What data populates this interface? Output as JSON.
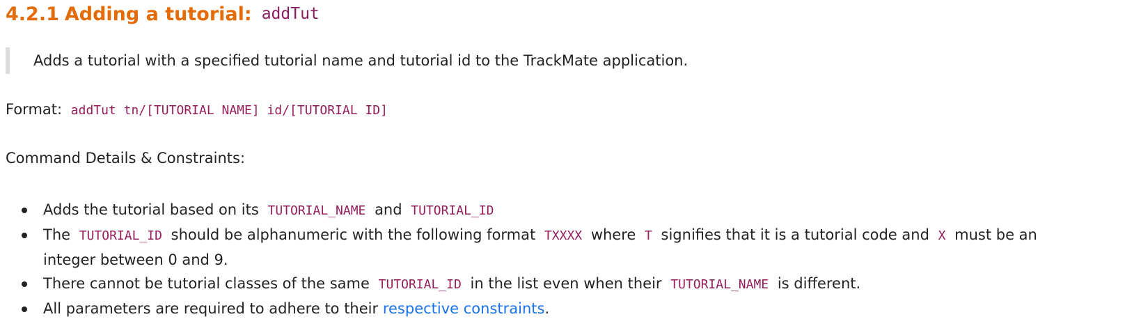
{
  "heading": {
    "number": "4.2.1",
    "title": "Adding a tutorial:",
    "command": "addTut"
  },
  "description": "Adds a tutorial with a specified tutorial name and tutorial id to the TrackMate application.",
  "format": {
    "label": "Format:",
    "syntax": "addTut tn/[TUTORIAL NAME] id/[TUTORIAL ID]"
  },
  "details_heading": "Command Details & Constraints:",
  "bullets": [
    {
      "t1": "Adds the tutorial based on its",
      "c1": "TUTORIAL_NAME",
      "t2": "and",
      "c2": "TUTORIAL_ID"
    },
    {
      "t1": "The",
      "c1": "TUTORIAL_ID",
      "t2": "should be alphanumeric with the following format",
      "c2": "TXXXX",
      "t3": "where",
      "c3": "T",
      "t4": "signifies that it is a tutorial code and",
      "c4": "X",
      "t5": "must be an integer between 0 and 9."
    },
    {
      "t1": "There cannot be tutorial classes of the same",
      "c1": "TUTORIAL_ID",
      "t2": "in the list even when their",
      "c2": "TUTORIAL_NAME",
      "t3": "is different."
    },
    {
      "t1": "All parameters are required to adhere to their",
      "link": "respective constraints",
      "t2": "."
    }
  ],
  "colors": {
    "heading": "#e36c09",
    "code": "#961d5b",
    "link": "#1a73e8",
    "quote_border": "#dddddd"
  }
}
